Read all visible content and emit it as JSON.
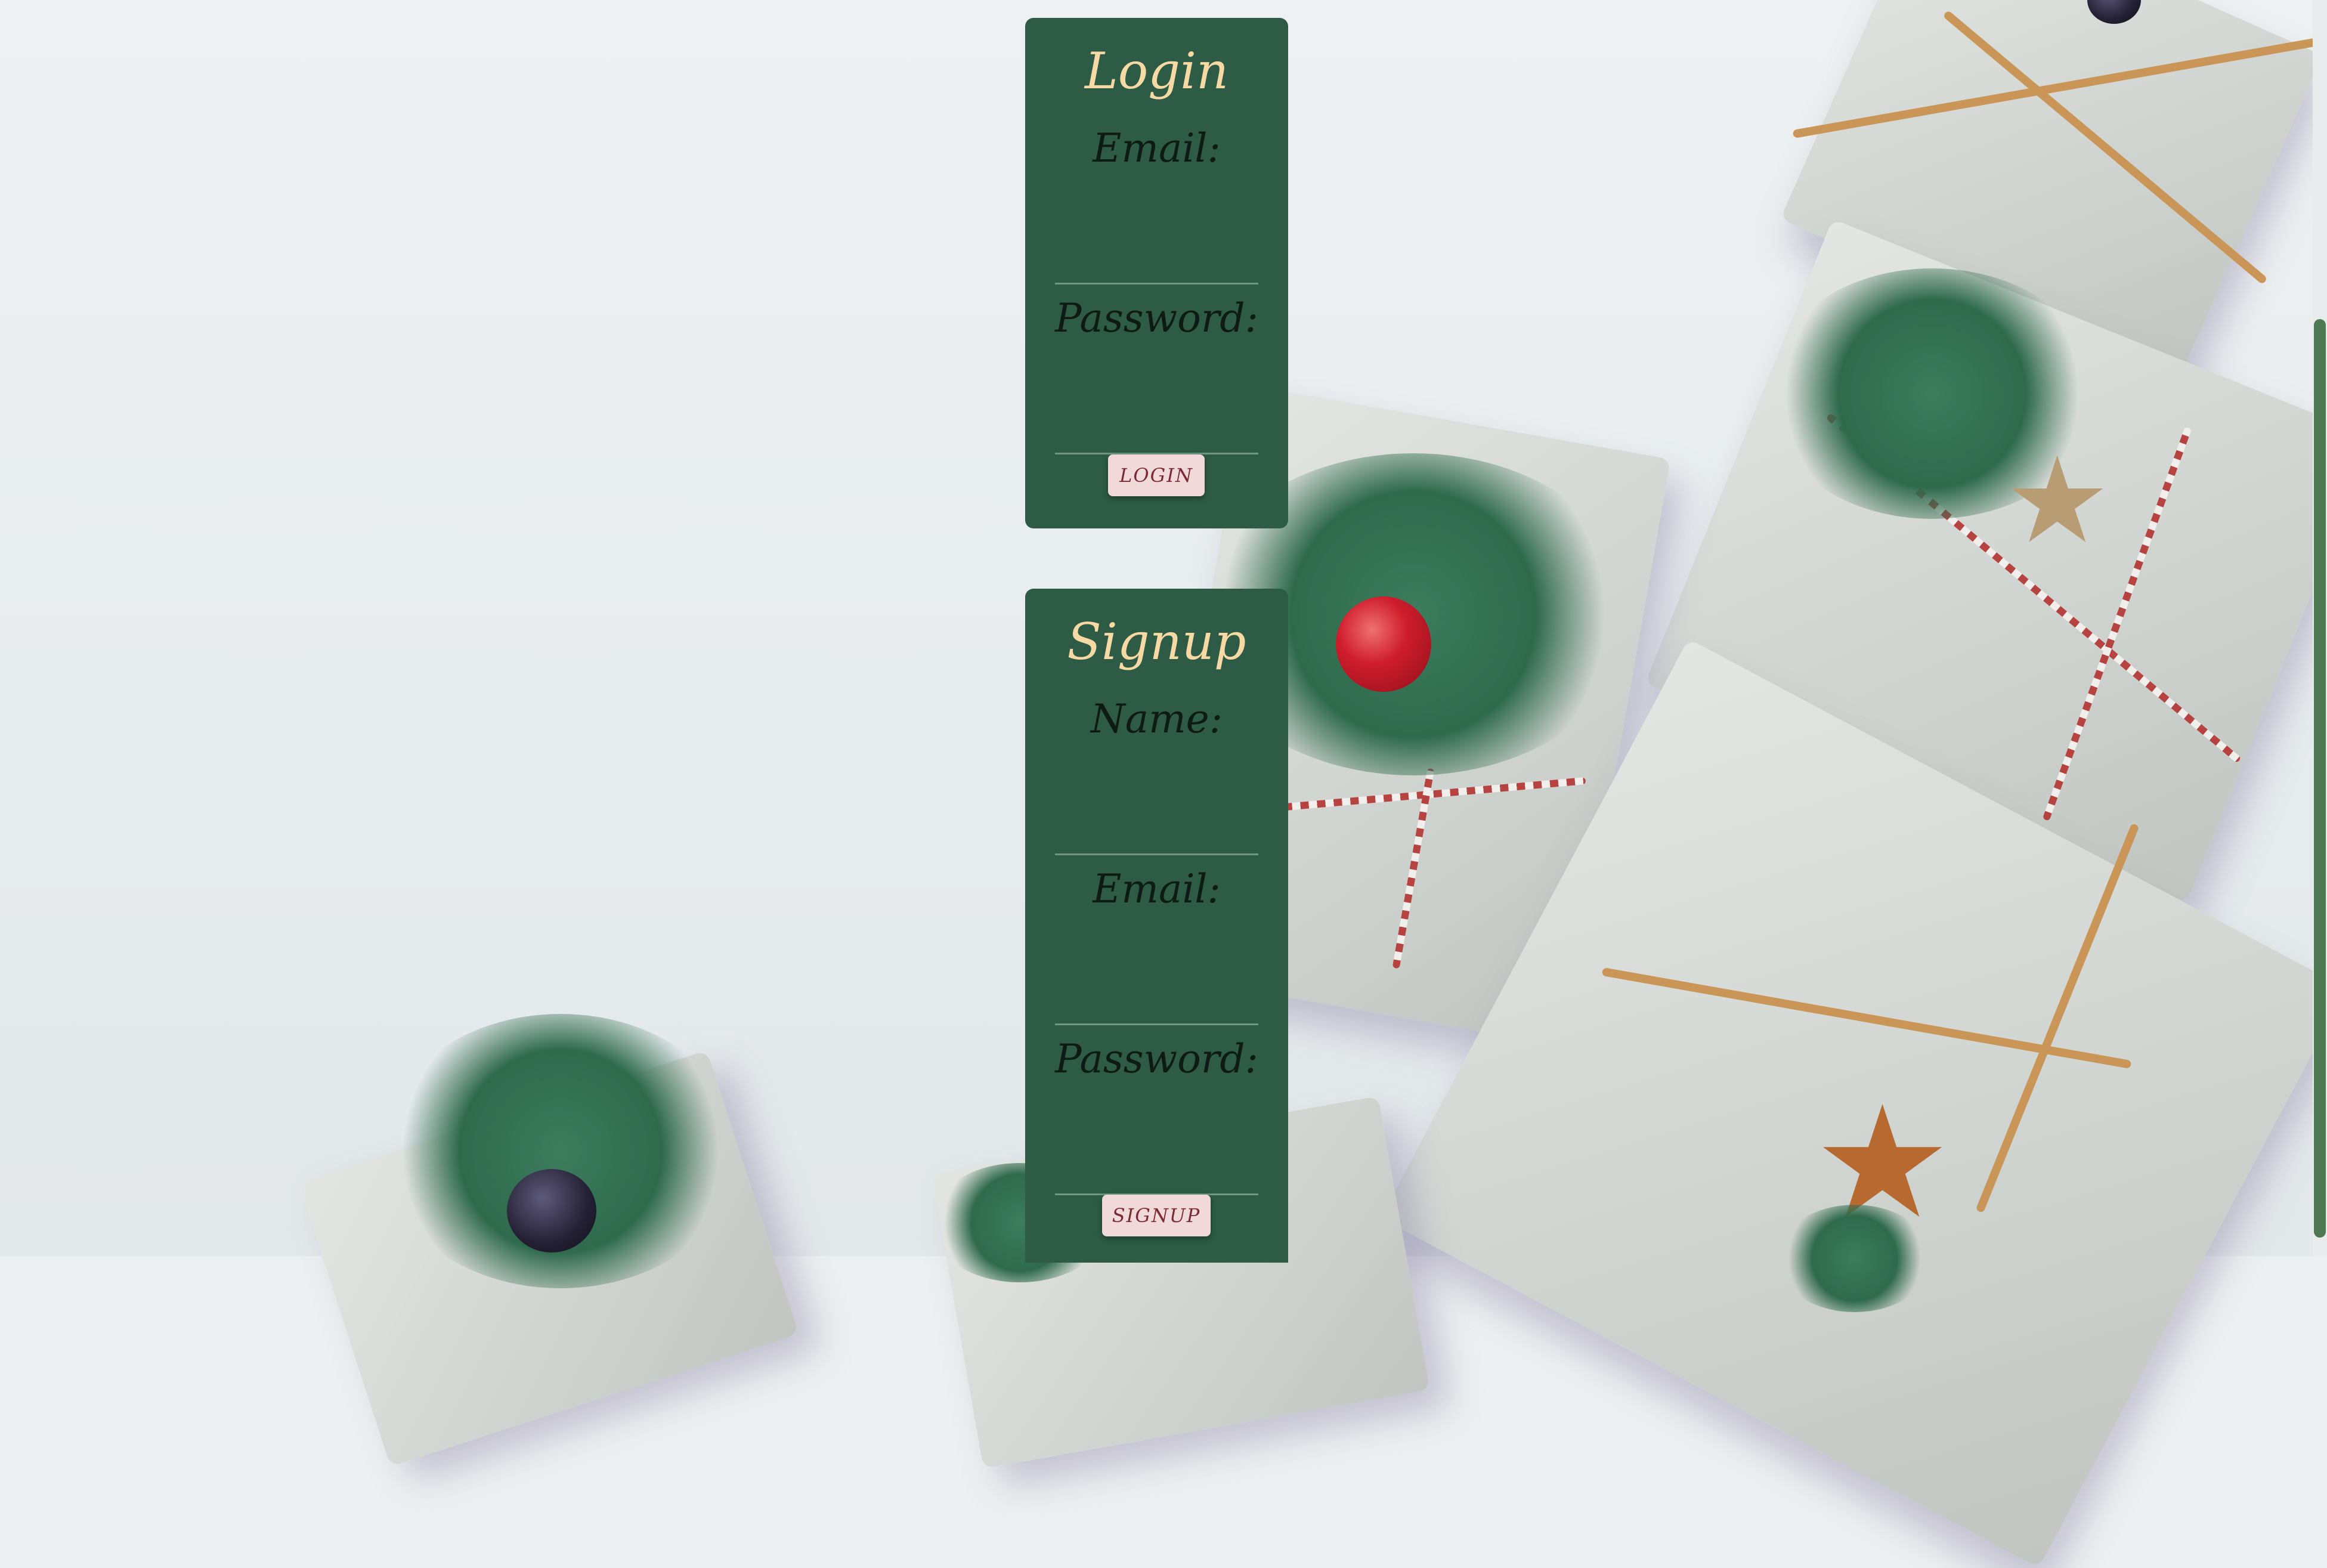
{
  "colors": {
    "card_background": "#2d5b45",
    "title_color": "#f7d9a3",
    "label_color": "#0e1a14",
    "button_background": "#f2d9d9",
    "button_text": "#7a2b33",
    "scrollbar_thumb": "#4d7a53"
  },
  "login": {
    "title": "Login",
    "email_label": "Email:",
    "email_value": "",
    "password_label": "Password:",
    "password_value": "",
    "button_label": "LOGIN"
  },
  "signup": {
    "title": "Signup",
    "name_label": "Name:",
    "name_value": "",
    "email_label": "Email:",
    "email_value": "",
    "password_label": "Password:",
    "password_value": "",
    "button_label": "SIGNUP"
  },
  "background": {
    "description_icon": "christmas-gifts-photo"
  }
}
